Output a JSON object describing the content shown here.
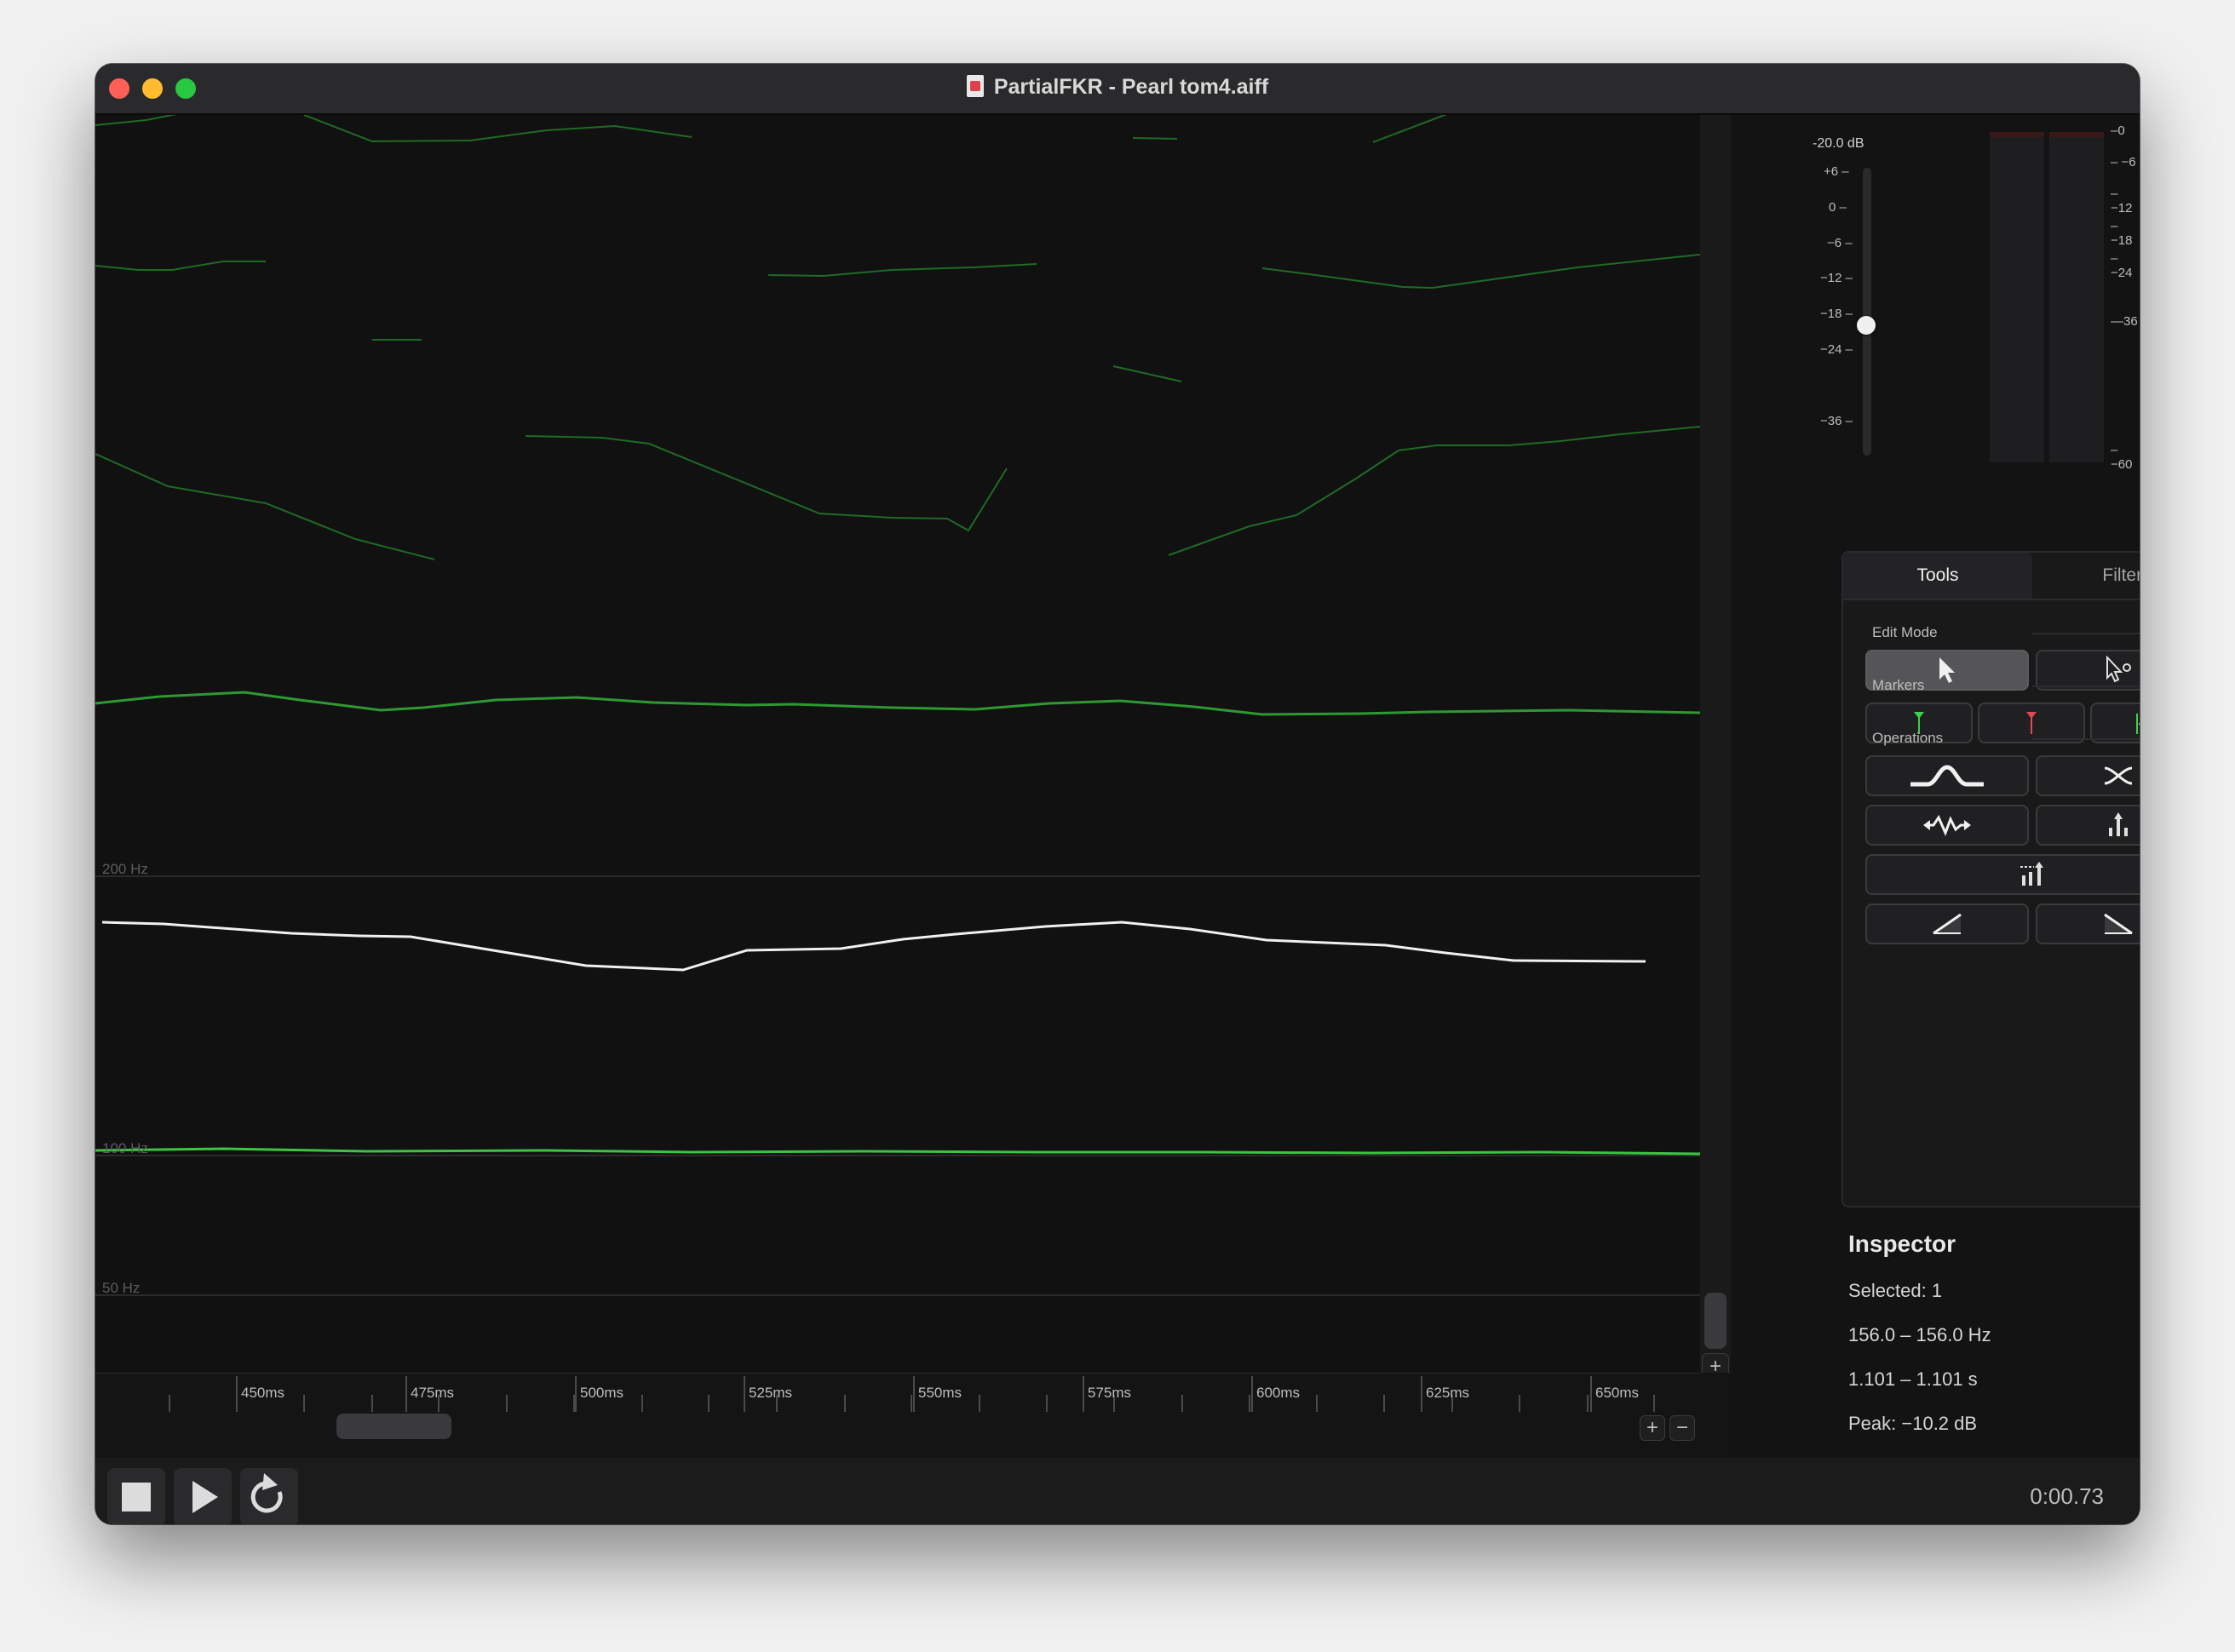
{
  "window": {
    "title": "PartialFKR - Pearl tom4.aiff"
  },
  "plot": {
    "freq_labels": [
      "200 Hz",
      "100 Hz",
      "50 Hz"
    ],
    "colors": {
      "partial": "#2a8a2e",
      "partial_bright": "#3fbf45",
      "selected": "#f2f2f2"
    }
  },
  "timeline": {
    "ticks": [
      "450ms",
      "475ms",
      "500ms",
      "525ms",
      "550ms",
      "575ms",
      "600ms",
      "625ms",
      "650ms"
    ]
  },
  "zoom": {
    "plus": "+",
    "minus": "−"
  },
  "meter": {
    "gain_db": "-20.0 dB",
    "gain_level_db": -20.0,
    "gain_scale": [
      "+6 –",
      "0 –",
      "−6 –",
      "−12 –",
      "−18 –",
      "−24 –",
      "−36 –"
    ],
    "meter_scale": [
      "–0",
      "– −6",
      "– −12",
      "– −18",
      "– −24",
      "—36",
      "– −60"
    ]
  },
  "tabs": [
    {
      "label": "Tools",
      "active": true
    },
    {
      "label": "Filters",
      "active": false
    }
  ],
  "tools": {
    "edit_mode_label": "Edit Mode",
    "markers_label": "Markers",
    "operations_label": "Operations"
  },
  "inspector": {
    "title": "Inspector",
    "selected": "Selected: 1",
    "freq_range": "156.0 – 156.0 Hz",
    "time_range": "1.101 – 1.101 s",
    "peak": "Peak: −10.2 dB"
  },
  "transport": {
    "time": "0:00.73"
  }
}
